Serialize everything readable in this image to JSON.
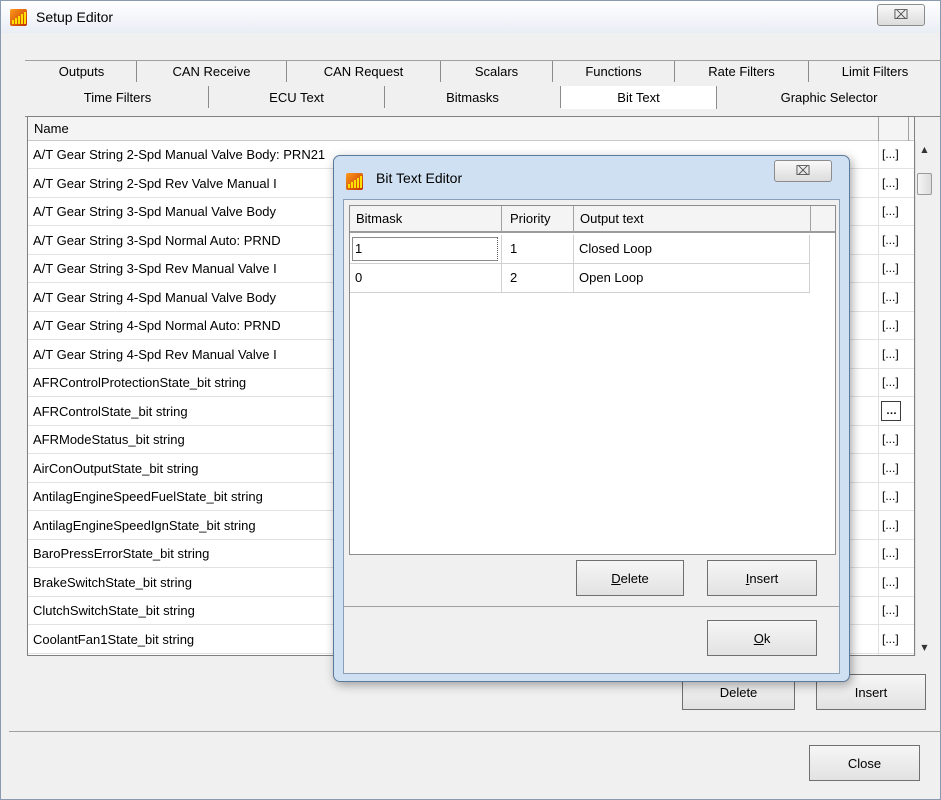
{
  "window": {
    "title": "Setup Editor",
    "close_glyph": "⌧"
  },
  "tabs_row1": [
    "Outputs",
    "CAN Receive",
    "CAN Request",
    "Scalars",
    "Functions",
    "Rate Filters",
    "Limit Filters"
  ],
  "tabs_row2": [
    "Time Filters",
    "ECU Text",
    "Bitmasks",
    "Bit Text",
    "Graphic Selector"
  ],
  "selected_tab": "Bit Text",
  "grid": {
    "header": "Name",
    "ellipsis": "[...]",
    "active_ellipsis": "…",
    "rows": [
      "A/T Gear String 2-Spd Manual Valve Body: PRN21",
      "A/T Gear String 2-Spd Rev Valve Manual I",
      "A/T Gear String 3-Spd Manual Valve Body",
      "A/T Gear String 3-Spd Normal Auto: PRND",
      "A/T Gear String 3-Spd Rev Manual Valve I",
      "A/T Gear String 4-Spd Manual Valve Body",
      "A/T Gear String 4-Spd Normal Auto: PRND",
      "A/T Gear String 4-Spd Rev Manual Valve I",
      "AFRControlProtectionState_bit string",
      "AFRControlState_bit string",
      "AFRModeStatus_bit string",
      "AirConOutputState_bit string",
      "AntilagEngineSpeedFuelState_bit string",
      "AntilagEngineSpeedIgnState_bit string",
      "BaroPressErrorState_bit string",
      "BrakeSwitchState_bit string",
      "ClutchSwitchState_bit string",
      "CoolantFan1State_bit string"
    ]
  },
  "buttons": {
    "delete": "Delete",
    "insert": "Insert",
    "close": "Close"
  },
  "dialog": {
    "title": "Bit Text Editor",
    "close_glyph": "⌧",
    "columns": [
      "Bitmask",
      "Priority",
      "Output text"
    ],
    "rows": [
      {
        "bitmask": "1",
        "priority": "1",
        "text": "Closed Loop"
      },
      {
        "bitmask": "0",
        "priority": "2",
        "text": "Open Loop"
      }
    ],
    "delete_hotkey": "D",
    "delete_rest": "elete",
    "insert_hotkey": "I",
    "insert_rest": "nsert",
    "ok_hotkey": "O",
    "ok_rest": "k"
  },
  "icons": {
    "app": "setup-editor-app-icon",
    "scroll_up": "scroll-up-arrow-icon",
    "scroll_down": "scroll-down-arrow-icon"
  }
}
